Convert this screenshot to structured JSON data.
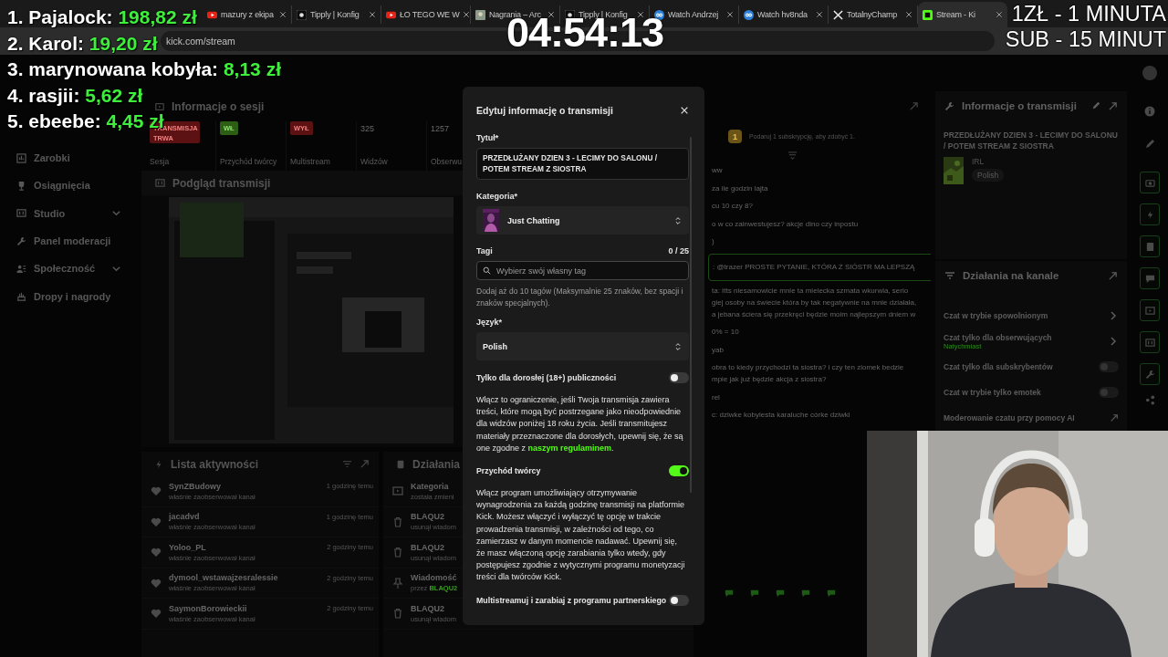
{
  "browser": {
    "tabs": [
      {
        "kind": "video",
        "title": "mazury z ekipa",
        "selected": false
      },
      {
        "kind": "app",
        "title": "Tipply | Konfig",
        "selected": false
      },
      {
        "kind": "video",
        "title": "ŁO TEGO WE W",
        "selected": false
      },
      {
        "kind": "thumbnail",
        "title": "Nagrania – Arc",
        "selected": false
      },
      {
        "kind": "app",
        "title": "Tipply | Konfig",
        "selected": false
      },
      {
        "kind": "link",
        "title": "Watch Andrzej",
        "selected": false
      },
      {
        "kind": "link",
        "title": "Watch hv8nda",
        "selected": false
      },
      {
        "kind": "cross",
        "title": "TotalnyChamp",
        "selected": false
      },
      {
        "kind": "brand",
        "title": "Stream - Ki",
        "selected": true
      }
    ],
    "address": "kick.com/stream"
  },
  "dashboard": {
    "sidebar": [
      {
        "kind": "link",
        "label": "Zarobki"
      },
      {
        "kind": "link",
        "label": "Osiągnięcia"
      },
      {
        "kind": "group",
        "label": "Studio"
      },
      {
        "kind": "link",
        "label": "Panel moderacji"
      },
      {
        "kind": "group",
        "label": "Społeczność"
      },
      {
        "kind": "link",
        "label": "Dropy i nagrody"
      }
    ],
    "session": {
      "title": "Informacje o sesji",
      "stats": [
        {
          "kind": "badge",
          "badge": "TRANSMISJA TRWA",
          "color": "#5c1212",
          "label": "Sesja"
        },
        {
          "kind": "badge",
          "badge": "WŁ",
          "color": "#2c5f14",
          "label": "Przychód twórcy"
        },
        {
          "kind": "badge",
          "badge": "WYŁ",
          "color": "#5c1212",
          "label": "Multistream"
        },
        {
          "kind": "number",
          "value": "325",
          "label": "Widzów"
        },
        {
          "kind": "number",
          "value": "1257",
          "label": "Obserwu"
        }
      ]
    },
    "preview": {
      "title": "Podgląd transmisji",
      "kind": "picture"
    },
    "activity": {
      "title": "Lista aktywności",
      "items": [
        {
          "user": "SynZBudowy",
          "action": "właśnie zaobserwował kanał",
          "time": "1 godzinę temu"
        },
        {
          "user": "jacadvd",
          "action": "właśnie zaobserwował kanał",
          "time": "1 godzinę temu"
        },
        {
          "user": "Yoloo_PL",
          "action": "właśnie zaobserwował kanał",
          "time": "2 godziny temu"
        },
        {
          "user": "dymool_wstawajzesralessie",
          "action": "właśnie zaobserwował kanał",
          "time": "2 godziny temu"
        },
        {
          "user": "SaymonBorowieckii",
          "action": "właśnie zaobserwował kanał",
          "time": "2 godziny temu"
        }
      ]
    },
    "actions": {
      "title": "Działania",
      "items": [
        {
          "kind": "category",
          "title": "Kategoria",
          "detail": "została zmieni"
        },
        {
          "kind": "delete",
          "title": "BLAQU2",
          "detail": "usunął wiadom"
        },
        {
          "kind": "delete",
          "title": "BLAQU2",
          "detail": "usunął wiadom"
        },
        {
          "kind": "pin",
          "title": "Wiadomość",
          "detail": "przez",
          "user": "BLAQU2"
        },
        {
          "kind": "delete",
          "title": "BLAQU2",
          "detail": "usunął wiadom"
        }
      ]
    },
    "chat": {
      "badge": "1",
      "notice": "Podaruj 1 subskrypcję, aby zdobyć 1.",
      "messages": [
        {
          "text": "ww",
          "highlighted": false
        },
        {
          "text": "za ile godzin lajta",
          "highlighted": false
        },
        {
          "text": "cu 10 czy 8?",
          "highlighted": false
        },
        {
          "text": "o w co zainwestujesz? akcje dino czy inpostu",
          "highlighted": false
        },
        {
          "text": ")",
          "highlighted": false
        },
        {
          "text": ": @trazer PROSTE PYTANIE, KTÓRA Z SIÓSTR MA LEPSZĄ",
          "highlighted": true
        },
        {
          "text": "ta: Itts niesamowicie mnie ta mielecka szmata wkurwia, serio\ngiej osoby na świecie która by tak negatywnie na mnie działała,\na jebana ściera się przekręci będzie moim najlepszym dniem w",
          "highlighted": false
        },
        {
          "text": "0% = 10",
          "highlighted": false
        },
        {
          "text": "yab",
          "highlighted": false
        },
        {
          "text": "obra to kiedy przychodzi ta siostra? i czy ten ziomek bedzie\nmpie jak już będzie akcja z siostra?",
          "highlighted": false
        },
        {
          "text": "rel",
          "highlighted": false
        },
        {
          "text": "c: dziwke kobylesta karaluche córke dziwki",
          "highlighted": false
        }
      ]
    },
    "stream_info": {
      "title": "Informacje o transmisji",
      "stream_title": "PRZEDŁUŻANY DZIEN 3 - LECIMY DO SALONU / POTEM STREAM Z SIOSTRA",
      "category": "IRL",
      "language": "Polish"
    },
    "channel_actions": {
      "title": "Działania na kanale",
      "items": [
        {
          "kind": "menu",
          "label": "Czat w trybie spowolnionym"
        },
        {
          "kind": "menu",
          "label": "Czat tylko dla obserwujących",
          "status": "Natychmiast"
        },
        {
          "kind": "toggle",
          "label": "Czat tylko dla subskrybentów",
          "on": false
        },
        {
          "kind": "toggle",
          "label": "Czat w trybie tylko emotek",
          "on": false
        },
        {
          "kind": "link",
          "label": "Moderowanie czatu przy pomocy AI"
        }
      ]
    }
  },
  "edit_modal": {
    "title": "Edytuj informację o transmisji",
    "fields": [
      {
        "kind": "text",
        "label": "Tytuł*",
        "value": "PRZEDŁUŻANY DZIEN 3 - LECIMY DO SALONU / POTEM STREAM Z SIOSTRA"
      },
      {
        "kind": "select",
        "label": "Kategoria*",
        "value": "Just Chatting",
        "thumbnail": true
      },
      {
        "kind": "tags",
        "label": "Tagi",
        "count": "0 / 25",
        "placeholder": "Wybierz swój własny tag",
        "hint": "Dodaj aż do 10 tagów (Maksymalnie 25 znaków, bez spacji i znaków specjalnych)."
      },
      {
        "kind": "select",
        "label": "Język*",
        "value": "Polish",
        "thumbnail": false
      }
    ],
    "toggles": [
      {
        "label": "Tylko dla dorosłej (18+) publiczności",
        "on": false,
        "description": "Włącz to ograniczenie, jeśli Twoja transmisja zawiera treści, które mogą być postrzegane jako nieodpowiednie dla widzów poniżej 18 roku życia. Jeśli transmitujesz materiały przeznaczone dla dorosłych, upewnij się, że są one zgodne z",
        "link": "naszym regulaminem",
        "description_end": "."
      },
      {
        "label": "Przychód twórcy",
        "on": true,
        "description": "Włącz program umożliwiający otrzymywanie wynagrodzenia za każdą godzinę transmisji na platformie Kick. Możesz włączyć i wyłączyć tę opcję w trakcie prowadzenia transmisji, w zależności od tego, co zamierzasz w danym momencie nadawać. Upewnij się, że masz włączoną opcję zarabiania tylko wtedy, gdy postępujesz zgodnie z wytycznymi programu monetyzacji treści dla twórców Kick."
      },
      {
        "label": "Multistreamuj i zarabiaj z programu partnerskiego",
        "on": false
      }
    ]
  },
  "overlay": {
    "leaderboard": [
      {
        "rank": "1.",
        "name": "Pajalock:",
        "amount": "198,82 zł"
      },
      {
        "rank": "2.",
        "name": "Karol:",
        "amount": "19,20 zł"
      },
      {
        "rank": "3.",
        "name": "marynowana kobyła:",
        "amount": "8,13 zł"
      },
      {
        "rank": "4.",
        "name": "rasjii:",
        "amount": "5,62 zł"
      },
      {
        "rank": "5.",
        "name": "ebeebe:",
        "amount": "4,45 zł"
      }
    ],
    "timer": "04:54:13",
    "rules": [
      "1ZŁ - 1 MINUTA",
      "SUB - 15 MINUT"
    ],
    "webcam": {
      "kind": "picture"
    }
  }
}
